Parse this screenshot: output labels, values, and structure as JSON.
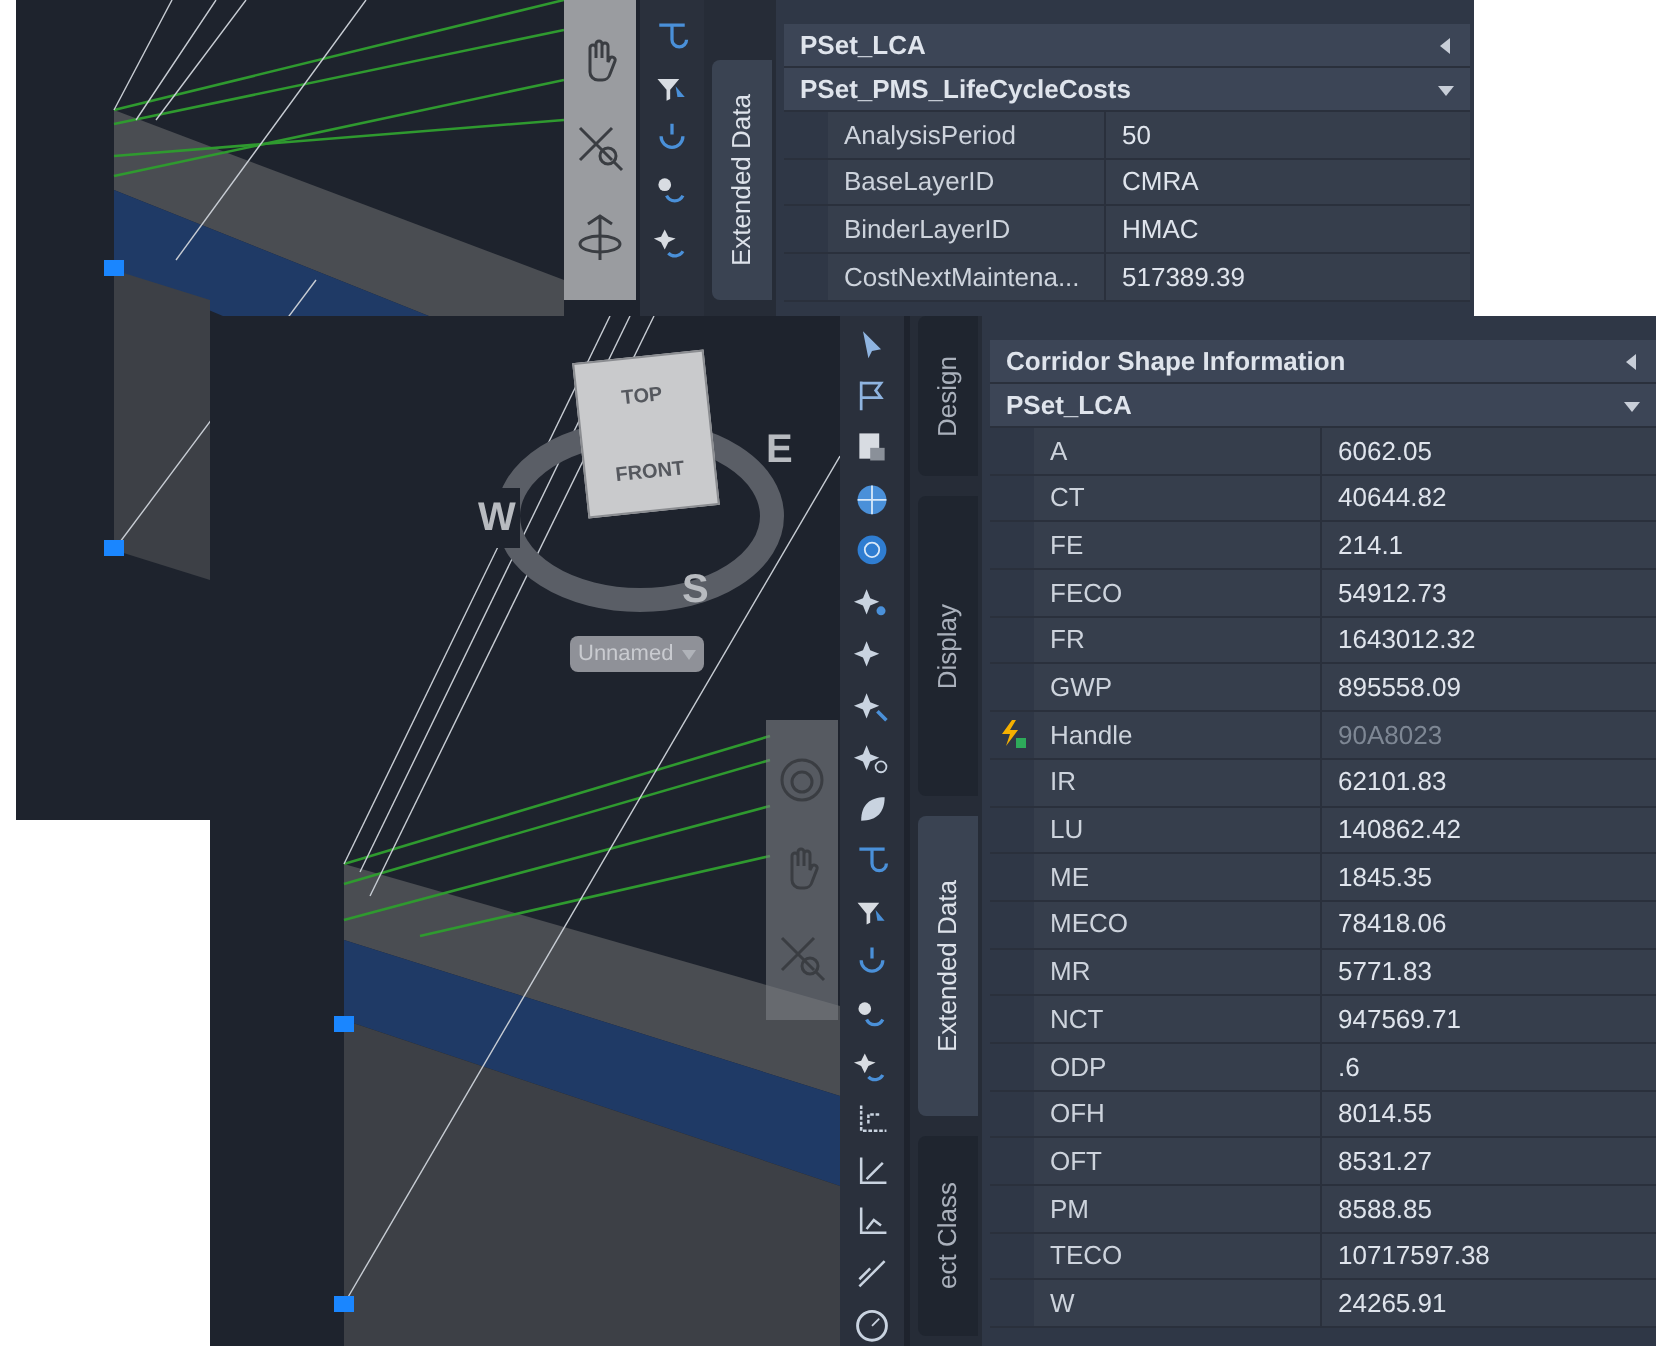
{
  "back_window": {
    "side_tabs": [
      {
        "label": "Extended Data",
        "selected": true
      }
    ],
    "property_sets": [
      {
        "title": "PSet_LCA",
        "expanded": false
      },
      {
        "title": "PSet_PMS_LifeCycleCosts",
        "expanded": true
      }
    ],
    "rows": [
      {
        "name": "AnalysisPeriod",
        "value": "50",
        "read_only": false
      },
      {
        "name": "BaseLayerID",
        "value": "CMRA",
        "read_only": false
      },
      {
        "name": "BinderLayerID",
        "value": "HMAC",
        "read_only": false
      },
      {
        "name": "CostNextMaintena...",
        "value": "517389.39",
        "read_only": false
      }
    ]
  },
  "front_window": {
    "viewcube": {
      "top": "TOP",
      "front": "FRONT",
      "west": "W",
      "east": "E",
      "south": "S",
      "view_menu": "Unnamed"
    },
    "side_tabs": [
      {
        "label": "Design",
        "selected": false
      },
      {
        "label": "Display",
        "selected": false
      },
      {
        "label": "Extended Data",
        "selected": true
      },
      {
        "label": "ect Class",
        "selected": false
      }
    ],
    "property_sets": [
      {
        "title": "Corridor Shape Information",
        "expanded": false
      },
      {
        "title": "PSet_LCA",
        "expanded": true
      }
    ],
    "rows": [
      {
        "name": "A",
        "value": "6062.05",
        "read_only": false
      },
      {
        "name": "CT",
        "value": "40644.82",
        "read_only": false
      },
      {
        "name": "FE",
        "value": "214.1",
        "read_only": false
      },
      {
        "name": "FECO",
        "value": "54912.73",
        "read_only": false
      },
      {
        "name": "FR",
        "value": "1643012.32",
        "read_only": false
      },
      {
        "name": "GWP",
        "value": "895558.09",
        "read_only": false
      },
      {
        "name": "Handle",
        "value": "90A8023",
        "read_only": true
      },
      {
        "name": "IR",
        "value": "62101.83",
        "read_only": false
      },
      {
        "name": "LU",
        "value": "140862.42",
        "read_only": false
      },
      {
        "name": "ME",
        "value": "1845.35",
        "read_only": false
      },
      {
        "name": "MECO",
        "value": "78418.06",
        "read_only": false
      },
      {
        "name": "MR",
        "value": "5771.83",
        "read_only": false
      },
      {
        "name": "NCT",
        "value": "947569.71",
        "read_only": false
      },
      {
        "name": "ODP",
        "value": ".6",
        "read_only": false
      },
      {
        "name": "OFH",
        "value": "8014.55",
        "read_only": false
      },
      {
        "name": "OFT",
        "value": "8531.27",
        "read_only": false
      },
      {
        "name": "PM",
        "value": "8588.85",
        "read_only": false
      },
      {
        "name": "TECO",
        "value": "10717597.38",
        "read_only": false
      },
      {
        "name": "W",
        "value": "24265.91",
        "read_only": false
      }
    ]
  }
}
